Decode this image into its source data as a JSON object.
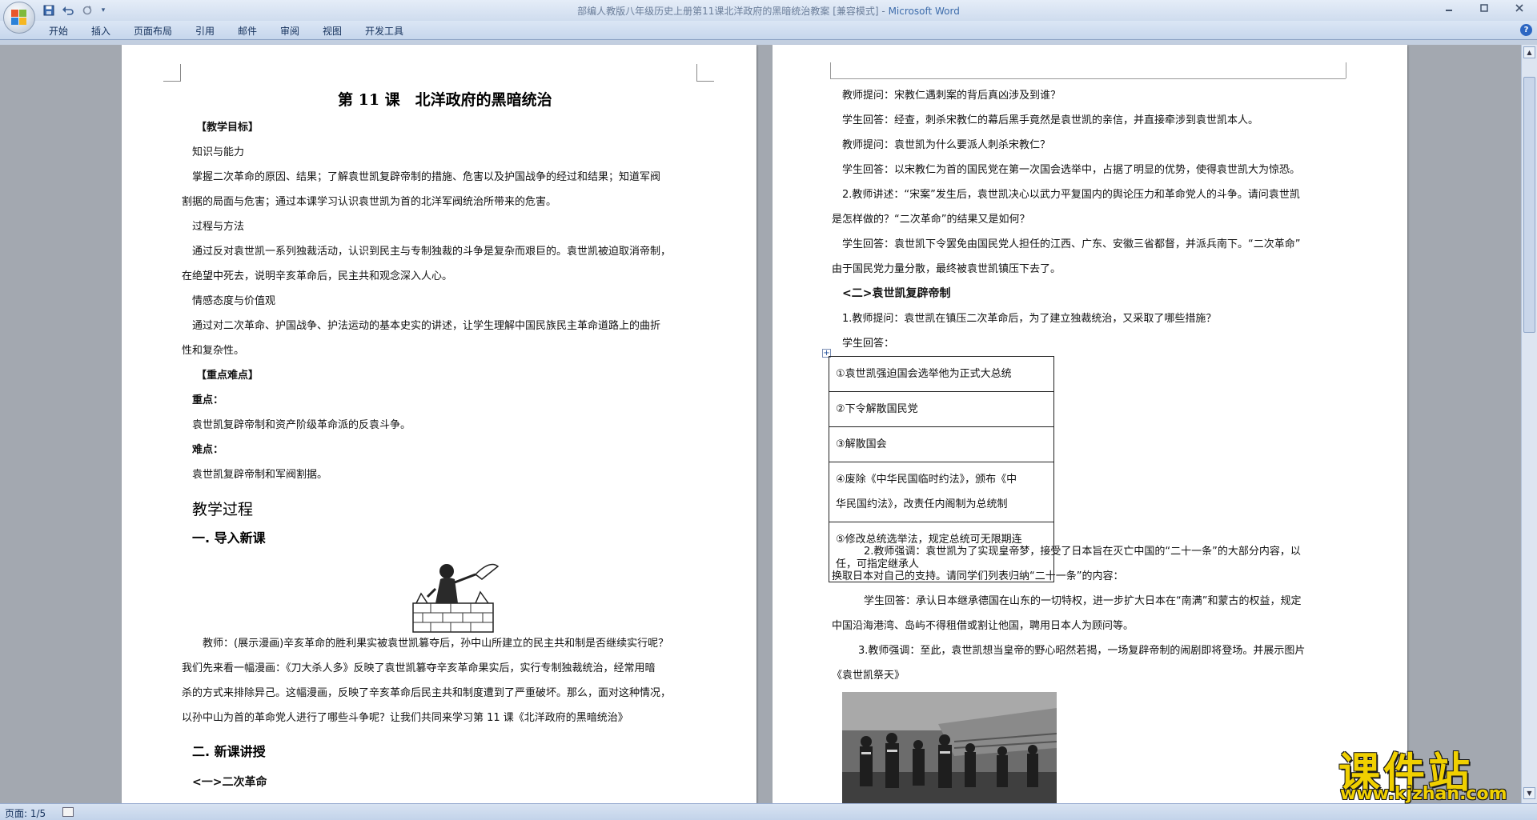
{
  "window": {
    "title": "部编人教版八年级历史上册第11课北洋政府的黑暗统治教案 [兼容模式] - ",
    "app_name": "Microsoft Word"
  },
  "ribbon_tabs": [
    "开始",
    "插入",
    "页面布局",
    "引用",
    "邮件",
    "审阅",
    "视图",
    "开发工具"
  ],
  "left_page": {
    "title": "第 11 课　北洋政府的黑暗统治",
    "goals_heading": "【教学目标】",
    "knowledge_label": "知识与能力",
    "knowledge_text_1": "掌握二次革命的原因、结果；了解袁世凯复辟帝制的措施、危害以及护国战争的经过和结果；知道军阀",
    "knowledge_text_2": "割据的局面与危害；通过本课学习认识袁世凯为首的北洋军阀统治所带来的危害。",
    "method_label": "过程与方法",
    "method_text_1": "通过反对袁世凯一系列独裁活动，认识到民主与专制独裁的斗争是复杂而艰巨的。袁世凯被迫取消帝制，",
    "method_text_2": "在绝望中死去，说明辛亥革命后，民主共和观念深入人心。",
    "emotion_label": "情感态度与价值观",
    "emotion_text_1": "通过对二次革命、护国战争、护法运动的基本史实的讲述，让学生理解中国民族民主革命道路上的曲折",
    "emotion_text_2": "性和复杂性。",
    "key_heading": "【重点难点】",
    "key_label": "重点：",
    "key_text": "袁世凯复辟帝制和资产阶级革命派的反袁斗争。",
    "difficult_label": "难点：",
    "difficult_text": "袁世凯复辟帝制和军阀割据。",
    "process_heading": "教学过程",
    "intro_heading": "一. 导入新课",
    "teacher_text_1": "教师：(展示漫画)辛亥革命的胜利果实被袁世凯篡夺后，孙中山所建立的民主共和制是否继续实行呢？",
    "teacher_text_2": "我们先来看一幅漫画：《刀大杀人多》反映了袁世凯篡夺辛亥革命果实后，实行专制独裁统治，经常用暗",
    "teacher_text_3": "杀的方式来排除异己。这幅漫画，反映了辛亥革命后民主共和制度遭到了严重破坏。那么，面对这种情况，",
    "teacher_text_4": "以孙中山为首的革命党人进行了哪些斗争呢？让我们共同来学习第 11 课《北洋政府的黑暗统治》",
    "new_heading": "二. 新课讲授",
    "sub_heading_1": "<一>二次革命"
  },
  "right_page": {
    "q1": "教师提问：宋教仁遇刺案的背后真凶涉及到谁？",
    "a1": "学生回答：经查，刺杀宋教仁的幕后黑手竟然是袁世凯的亲信，并直接牵涉到袁世凯本人。",
    "q2": "教师提问：袁世凯为什么要派人刺杀宋教仁？",
    "a2": "学生回答：以宋教仁为首的国民党在第一次国会选举中，占据了明显的优势，使得袁世凯大为惊恐。",
    "t2_1": "2.教师讲述：“宋案”发生后，袁世凯决心以武力平复国内的舆论压力和革命党人的斗争。请问袁世凯",
    "t2_2": "是怎样做的？“二次革命”的结果又是如何？",
    "a3_1": "学生回答：袁世凯下令罢免由国民党人担任的江西、广东、安徽三省都督，并派兵南下。“二次革命”",
    "a3_2": "由于国民党力量分散，最终被袁世凯镇压下去了。",
    "sub_heading_2": "<二>袁世凯复辟帝制",
    "q4": "1.教师提问：袁世凯在镇压二次革命后，为了建立独裁统治，又采取了哪些措施？",
    "a4_label": "学生回答：",
    "measures": [
      {
        "line1": "①袁世凯强迫国会选举他为正式大总统",
        "line2": ""
      },
      {
        "line1": "②下令解散国民党",
        "line2": ""
      },
      {
        "line1": "③解散国会",
        "line2": ""
      },
      {
        "line1": "④废除《中华民国临时约法》，颁布《中",
        "line2": "华民国约法》，改责任内阁制为总统制"
      },
      {
        "line1": "⑤修改总统选举法，规定总统可无限期连",
        "line2": "任，可指定继承人"
      }
    ],
    "e2_1": "2.教师强调：袁世凯为了实现皇帝梦，接受了日本旨在灭亡中国的“二十一条”的大部分内容，以",
    "e2_2": "换取日本对自己的支持。请同学们列表归纳“二十一条”的内容：",
    "a5_1": "学生回答：承认日本继承德国在山东的一切特权，进一步扩大日本在“南满”和蒙古的权益，规定",
    "a5_2": "中国沿海港湾、岛屿不得租借或割让他国，聘用日本人为顾问等。",
    "e3_1": "3.教师强调：至此，袁世凯想当皇帝的野心昭然若揭，一场复辟帝制的闹剧即将登场。并展示图片",
    "e3_2": "《袁世凯祭天》"
  },
  "status_bar": {
    "page_info": "页面: 1/5"
  },
  "watermark": {
    "big": "课件站",
    "url": "www.kjzhan.com"
  },
  "icons": [
    "office-button-icon",
    "save-icon",
    "undo-icon",
    "redo-icon",
    "customize-qat-icon",
    "minimize-icon",
    "maximize-icon",
    "close-icon",
    "help-icon",
    "table-move-handle-icon",
    "scroll-up-icon",
    "scroll-down-icon",
    "proofing-status-icon"
  ],
  "colors": {
    "accent": "#3d6cab",
    "watermark": "#f0d000"
  }
}
